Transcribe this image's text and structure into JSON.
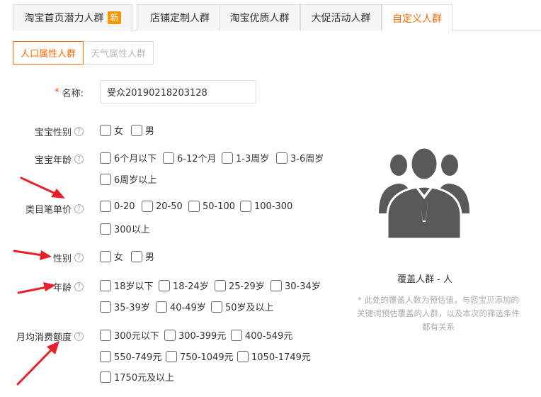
{
  "tabs": [
    {
      "label": "淘宝首页潜力人群",
      "badge": "新"
    },
    {
      "label": "店铺定制人群"
    },
    {
      "label": "淘宝优质人群"
    },
    {
      "label": "大促活动人群"
    },
    {
      "label": "自定义人群"
    }
  ],
  "subtabs": [
    "人口属性人群",
    "天气属性人群"
  ],
  "form": {
    "name": {
      "required_mark": "*",
      "label": "名称:",
      "value": "受众20190218203128"
    },
    "baby_gender": {
      "label": "宝宝性别",
      "help": "?",
      "options": [
        "女",
        "男"
      ]
    },
    "baby_age": {
      "label": "宝宝年龄",
      "help": "?",
      "options": [
        "6个月以下",
        "6-12个月",
        "1-3周岁",
        "3-6周岁",
        "6周岁以上"
      ]
    },
    "category_price": {
      "label": "类目笔单价",
      "help": "?",
      "options": [
        "0-20",
        "20-50",
        "50-100",
        "100-300",
        "300以上"
      ]
    },
    "gender": {
      "label": "性别",
      "help": "?",
      "options": [
        "女",
        "男"
      ]
    },
    "age": {
      "label": "年龄",
      "help": "?",
      "options": [
        "18岁以下",
        "18-24岁",
        "25-29岁",
        "30-34岁",
        "35-39岁",
        "40-49岁",
        "50岁及以上"
      ]
    },
    "monthly_spend": {
      "label": "月均消费额度",
      "help": "?",
      "options": [
        "300元以下",
        "300-399元",
        "400-549元",
        "550-749元",
        "750-1049元",
        "1050-1749元",
        "1750元及以上"
      ]
    }
  },
  "coverage": {
    "label": "覆盖人群",
    "dash": "-",
    "unit": "人",
    "note_lines": [
      "* 此处的覆盖人数为预估值，与您宝贝添加的",
      "关键词预估覆盖的人群，以及本次的筛选条件",
      "都有关系"
    ]
  },
  "icons": {
    "people": "people-group-icon",
    "arrow": "annotation-arrow-icon"
  },
  "colors": {
    "accent": "#ff6a00",
    "badge": "#f39800",
    "arrow": "#e8202a",
    "icon": "#595959"
  }
}
